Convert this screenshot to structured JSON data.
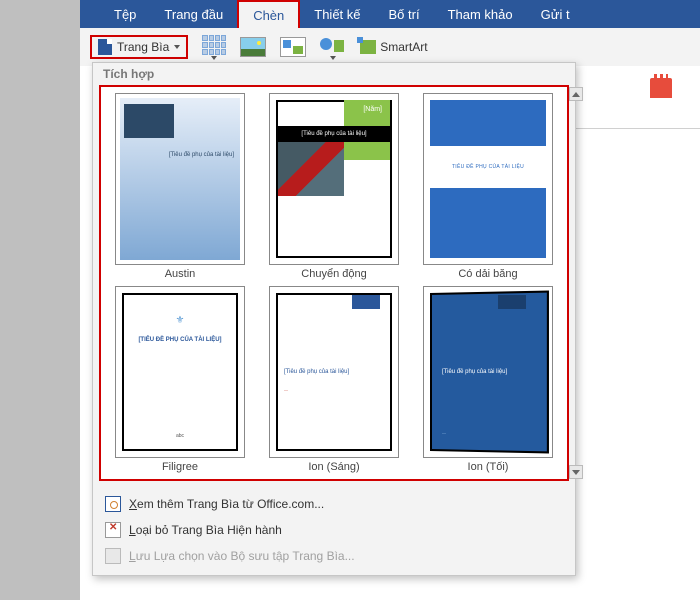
{
  "tabs": {
    "tep": "Tệp",
    "trangdau": "Trang đầu",
    "chen": "Chèn",
    "thietke": "Thiết kế",
    "botri": "Bố trí",
    "thamkhao": "Tham khảo",
    "guit": "Gửi t"
  },
  "toolbar": {
    "trangbia_label": "Trang Bìa",
    "smartart_label": "SmartArt"
  },
  "dropdown": {
    "section": "Tích hợp",
    "templates": {
      "austin": {
        "label": "Austin",
        "subtitle": "[Tiêu đề phụ của tài liệu]"
      },
      "chuyendong": {
        "label": "Chuyển động",
        "year": "[Năm]",
        "bar": "[Tiêu đề phụ của tài liệu]"
      },
      "codaibang": {
        "label": "Có dải băng",
        "mid": "TIÊU ĐỀ PHỤ CỦA TÀI LIỆU"
      },
      "filigree": {
        "label": "Filigree",
        "title": "[TIÊU ĐỀ PHỤ CỦA TÀI LIỆU]",
        "bot": "abc"
      },
      "ionsang": {
        "label": "Ion (Sáng)",
        "title": "[Tiêu đề phụ của tài liệu]"
      },
      "iontoi": {
        "label": "Ion (Tối)",
        "title": "[Tiêu đề phụ của tài liệu]"
      }
    },
    "footer": {
      "more_pre": "X",
      "more_rest": "em thêm Trang Bìa từ Office.com...",
      "remove_pre": "L",
      "remove_rest": "oại bỏ Trang Bìa Hiện hành",
      "save_pre": "L",
      "save_rest": "ưu Lựa chọn vào Bộ sưu tập Trang Bìa..."
    }
  }
}
